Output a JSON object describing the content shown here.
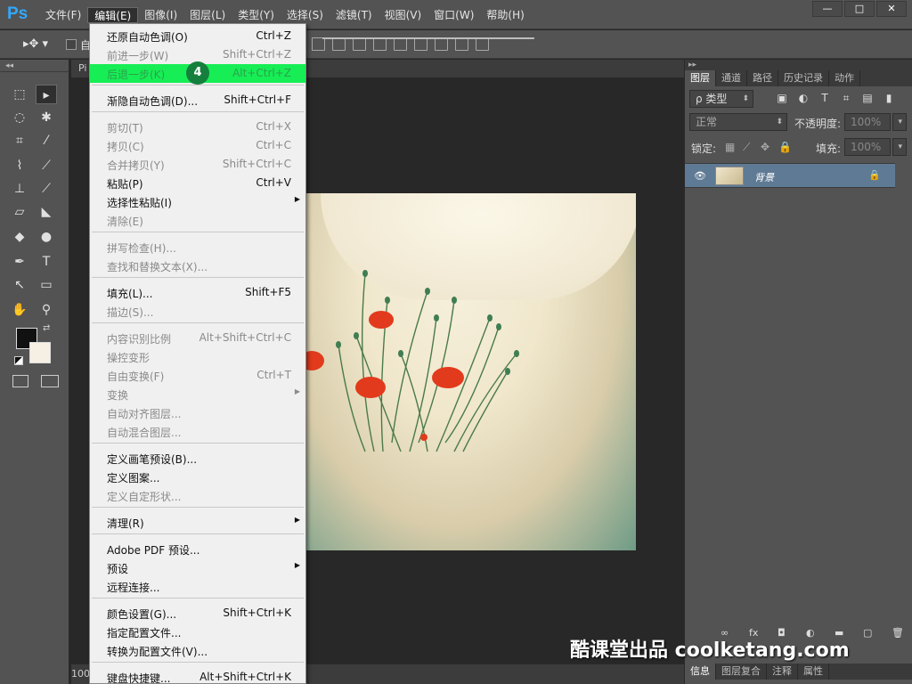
{
  "app": {
    "logo": "Ps",
    "doc_tab": "Pi",
    "zoom": "100"
  },
  "menubar": {
    "items": [
      "文件(F)",
      "编辑(E)",
      "图像(I)",
      "图层(L)",
      "类型(Y)",
      "选择(S)",
      "滤镜(T)",
      "视图(V)",
      "窗口(W)",
      "帮助(H)"
    ],
    "window_buttons": [
      "—",
      "□",
      "✕"
    ]
  },
  "optbar": {
    "tool": "▸✥ ▾",
    "auto_label": "自"
  },
  "edit_menu": {
    "items": [
      {
        "label": "还原自动色调(O)",
        "shortcut": "Ctrl+Z",
        "disabled": false
      },
      {
        "label": "前进一步(W)",
        "shortcut": "Shift+Ctrl+Z",
        "disabled": true
      },
      {
        "label": "后退一步(K)",
        "shortcut": "Alt+Ctrl+Z",
        "disabled": false,
        "highlight": true
      },
      {
        "label": "渐隐自动色调(D)...",
        "shortcut": "Shift+Ctrl+F",
        "disabled": false
      },
      {
        "label": "剪切(T)",
        "shortcut": "Ctrl+X",
        "disabled": true
      },
      {
        "label": "拷贝(C)",
        "shortcut": "Ctrl+C",
        "disabled": true
      },
      {
        "label": "合并拷贝(Y)",
        "shortcut": "Shift+Ctrl+C",
        "disabled": true
      },
      {
        "label": "粘贴(P)",
        "shortcut": "Ctrl+V",
        "disabled": false
      },
      {
        "label": "选择性粘贴(I)",
        "shortcut": "",
        "disabled": false,
        "submenu": true
      },
      {
        "label": "清除(E)",
        "shortcut": "",
        "disabled": true
      },
      {
        "label": "拼写检查(H)...",
        "shortcut": "",
        "disabled": true
      },
      {
        "label": "查找和替换文本(X)...",
        "shortcut": "",
        "disabled": true
      },
      {
        "label": "填充(L)...",
        "shortcut": "Shift+F5",
        "disabled": false
      },
      {
        "label": "描边(S)...",
        "shortcut": "",
        "disabled": true
      },
      {
        "label": "内容识别比例",
        "shortcut": "Alt+Shift+Ctrl+C",
        "disabled": true
      },
      {
        "label": "操控变形",
        "shortcut": "",
        "disabled": true
      },
      {
        "label": "自由变换(F)",
        "shortcut": "Ctrl+T",
        "disabled": true
      },
      {
        "label": "变换",
        "shortcut": "",
        "disabled": true,
        "submenu": true
      },
      {
        "label": "自动对齐图层...",
        "shortcut": "",
        "disabled": true
      },
      {
        "label": "自动混合图层...",
        "shortcut": "",
        "disabled": true
      },
      {
        "label": "定义画笔预设(B)...",
        "shortcut": "",
        "disabled": false
      },
      {
        "label": "定义图案...",
        "shortcut": "",
        "disabled": false
      },
      {
        "label": "定义自定形状...",
        "shortcut": "",
        "disabled": true
      },
      {
        "label": "清理(R)",
        "shortcut": "",
        "disabled": false,
        "submenu": true
      },
      {
        "label": "Adobe PDF 预设...",
        "shortcut": "",
        "disabled": false
      },
      {
        "label": "预设",
        "shortcut": "",
        "disabled": false,
        "submenu": true
      },
      {
        "label": "远程连接...",
        "shortcut": "",
        "disabled": false
      },
      {
        "label": "颜色设置(G)...",
        "shortcut": "Shift+Ctrl+K",
        "disabled": false
      },
      {
        "label": "指定配置文件...",
        "shortcut": "",
        "disabled": false
      },
      {
        "label": "转换为配置文件(V)...",
        "shortcut": "",
        "disabled": false
      },
      {
        "label": "键盘快捷键...",
        "shortcut": "Alt+Shift+Ctrl+K",
        "disabled": false
      }
    ],
    "step_badge": "4"
  },
  "right_panel": {
    "tabs": [
      "图层",
      "通道",
      "路径",
      "历史记录",
      "动作"
    ],
    "filter_kind": "ρ 类型",
    "blend_mode": "正常",
    "opacity_label": "不透明度:",
    "opacity_value": "100%",
    "lock_label": "锁定:",
    "fill_label": "填充:",
    "fill_value": "100%",
    "layer_name": "背景",
    "bottom_tabs": [
      "信息",
      "图层复合",
      "注释",
      "属性"
    ]
  },
  "watermark": "酷课堂出品 coolketang.com"
}
